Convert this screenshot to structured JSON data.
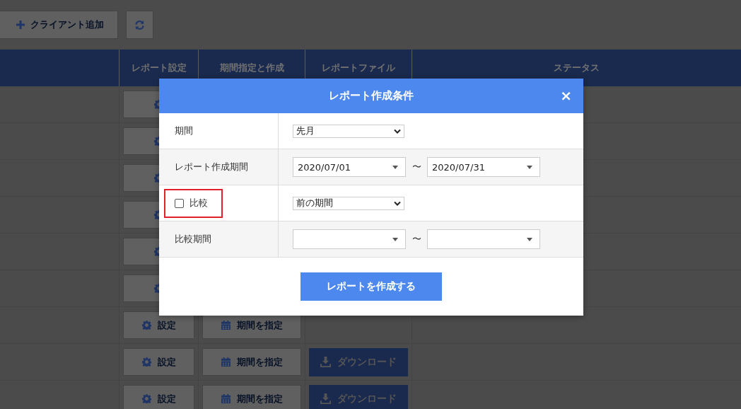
{
  "toolbar": {
    "add_button": "クライアント追加"
  },
  "table": {
    "columns": [
      "",
      "レポート設定",
      "期間指定と作成",
      "レポートファイル",
      "ステータス"
    ],
    "rows": [
      {
        "settings": "",
        "period": "",
        "download": ""
      },
      {
        "settings": "",
        "period": "",
        "download": ""
      },
      {
        "settings": "",
        "period": "",
        "download": ""
      },
      {
        "settings": "",
        "period": "",
        "download": ""
      },
      {
        "settings": "",
        "period": "",
        "download": ""
      },
      {
        "settings": "",
        "period": "",
        "download": ""
      },
      {
        "settings": "設定",
        "period": "期間を指定",
        "download": ""
      },
      {
        "settings": "設定",
        "period": "期間を指定",
        "download": "ダウンロード"
      },
      {
        "settings": "設定",
        "period": "期間を指定",
        "download": "ダウンロード"
      }
    ]
  },
  "dialog": {
    "title": "レポート作成条件",
    "close": "×",
    "rows": [
      {
        "kind": "select",
        "label": "期間",
        "value": "先月",
        "highlight": false
      },
      {
        "kind": "daterange",
        "label": "レポート作成期間",
        "from": "2020/07/01",
        "sep": "〜",
        "to": "2020/07/31",
        "highlight": false
      },
      {
        "kind": "checkselect",
        "label": "比較",
        "checked": false,
        "value": "前の期間",
        "highlight": true
      },
      {
        "kind": "daterange",
        "label": "比較期間",
        "from": "",
        "sep": "〜",
        "to": "",
        "highlight": false
      }
    ],
    "submit": "レポートを作成する"
  }
}
